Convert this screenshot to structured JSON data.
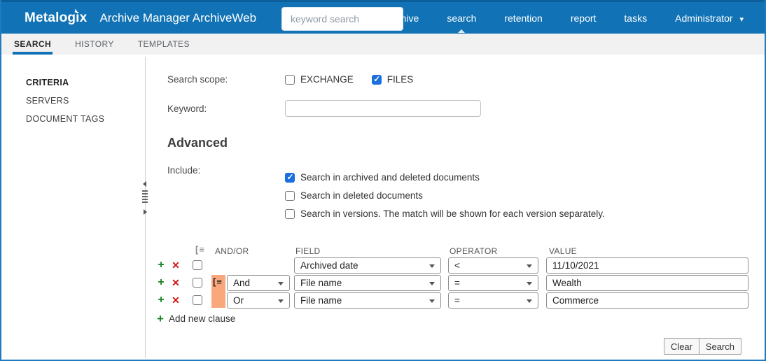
{
  "header": {
    "logo": "Metalogix",
    "app_title": "Archive Manager ArchiveWeb",
    "search_placeholder": "keyword search",
    "nav": [
      {
        "label": "archive",
        "active": false
      },
      {
        "label": "search",
        "active": true
      },
      {
        "label": "retention",
        "active": false
      },
      {
        "label": "report",
        "active": false
      },
      {
        "label": "tasks",
        "active": false
      },
      {
        "label": "Administrator",
        "active": false,
        "has_dropdown": true
      }
    ],
    "caret_down_glyph": "▾"
  },
  "tabs": [
    {
      "label": "SEARCH",
      "active": true
    },
    {
      "label": "HISTORY",
      "active": false
    },
    {
      "label": "TEMPLATES",
      "active": false
    }
  ],
  "sidebar": {
    "items": [
      {
        "label": "CRITERIA",
        "active": true
      },
      {
        "label": "SERVERS",
        "active": false
      },
      {
        "label": "DOCUMENT TAGS",
        "active": false
      }
    ]
  },
  "form": {
    "search_scope_label": "Search scope:",
    "scope_options": [
      {
        "label": "EXCHANGE",
        "checked": false
      },
      {
        "label": "FILES",
        "checked": true
      }
    ],
    "keyword_label": "Keyword:",
    "keyword_value": "",
    "advanced_heading": "Advanced",
    "include_label": "Include:",
    "include_options": [
      {
        "label": "Search in archived and deleted documents",
        "checked": true
      },
      {
        "label": "Search in deleted documents",
        "checked": false
      },
      {
        "label": "Search in versions. The match will be shown for each version separately.",
        "checked": false
      }
    ]
  },
  "clauses": {
    "headers": {
      "andor": "AND/OR",
      "field": "FIELD",
      "operator": "OPERATOR",
      "value": "VALUE"
    },
    "group_icon_glyph": "[≡",
    "add_glyph": "+",
    "delete_glyph": "✕",
    "rows": [
      {
        "andor": "",
        "field": "Archived date",
        "operator": "<",
        "value": "11/10/2021",
        "grouped": false
      },
      {
        "andor": "And",
        "field": "File name",
        "operator": "=",
        "value": "Wealth",
        "grouped": true
      },
      {
        "andor": "Or",
        "field": "File name",
        "operator": "=",
        "value": "Commerce",
        "grouped": true
      }
    ],
    "add_clause_label": "Add new clause"
  },
  "footer": {
    "clear_label": "Clear",
    "search_label": "Search"
  },
  "colors": {
    "header_blue": "#1173b6",
    "tab_underline_blue": "#1173b6",
    "checkbox_blue": "#1b6ee0",
    "group_orange": "#f9a87d",
    "add_green": "#15801c",
    "delete_red": "#cf1717",
    "page_border_blue": "#2279bd"
  }
}
